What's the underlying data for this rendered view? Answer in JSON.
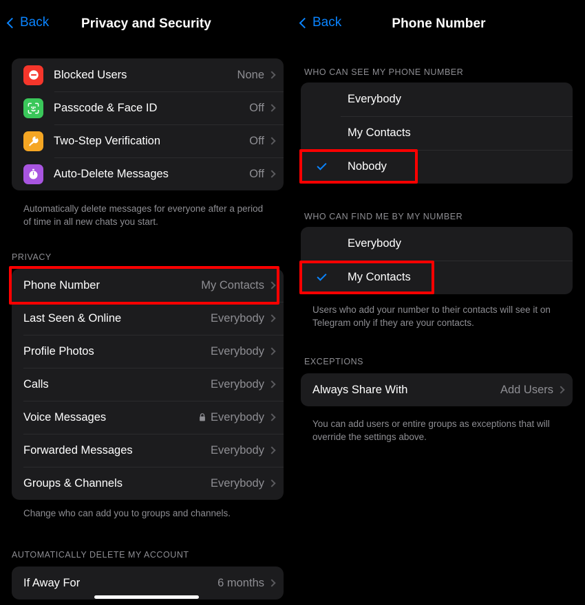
{
  "app": "Telegram iOS Settings",
  "left_panel": {
    "nav": {
      "back_label": "Back",
      "title": "Privacy and Security",
      "back_icon": "chevron-left-icon"
    },
    "security_card": {
      "rows": [
        {
          "icon": "blocked-users-icon",
          "icon_color": "#f5362b",
          "label": "Blocked Users",
          "value": "None"
        },
        {
          "icon": "face-id-icon",
          "icon_color": "#3ac75a",
          "label": "Passcode & Face ID",
          "value": "Off"
        },
        {
          "icon": "key-icon",
          "icon_color": "#f5a623",
          "label": "Two-Step Verification",
          "value": "Off"
        },
        {
          "icon": "timer-icon",
          "icon_color": "#a855e0",
          "label": "Auto-Delete Messages",
          "value": "Off"
        }
      ],
      "footnote": "Automatically delete messages for everyone after a period of time in all new chats you start."
    },
    "privacy_section": {
      "header": "PRIVACY",
      "rows": [
        {
          "label": "Phone Number",
          "value": "My Contacts",
          "highlighted": true
        },
        {
          "label": "Last Seen & Online",
          "value": "Everybody"
        },
        {
          "label": "Profile Photos",
          "value": "Everybody"
        },
        {
          "label": "Calls",
          "value": "Everybody"
        },
        {
          "label": "Voice Messages",
          "value": "Everybody",
          "lock_icon": "lock-icon"
        },
        {
          "label": "Forwarded Messages",
          "value": "Everybody"
        },
        {
          "label": "Groups & Channels",
          "value": "Everybody"
        }
      ],
      "footnote": "Change who can add you to groups and channels."
    },
    "delete_section": {
      "header": "AUTOMATICALLY DELETE MY ACCOUNT",
      "rows": [
        {
          "label": "If Away For",
          "value": "6 months"
        }
      ]
    }
  },
  "right_panel": {
    "nav": {
      "back_label": "Back",
      "title": "Phone Number",
      "back_icon": "chevron-left-icon"
    },
    "see_section": {
      "header": "WHO CAN SEE MY PHONE NUMBER",
      "options": [
        {
          "label": "Everybody",
          "selected": false
        },
        {
          "label": "My Contacts",
          "selected": false
        },
        {
          "label": "Nobody",
          "selected": true,
          "highlighted": true
        }
      ]
    },
    "find_section": {
      "header": "WHO CAN FIND ME BY MY NUMBER",
      "options": [
        {
          "label": "Everybody",
          "selected": false
        },
        {
          "label": "My Contacts",
          "selected": true,
          "highlighted": true
        }
      ],
      "footnote": "Users who add your number to their contacts will see it on Telegram only if they are your contacts."
    },
    "exceptions_section": {
      "header": "EXCEPTIONS",
      "rows": [
        {
          "label": "Always Share With",
          "value": "Add Users"
        }
      ],
      "footnote": "You can add users or entire groups as exceptions that will override the settings above."
    }
  },
  "colors": {
    "background": "#000000",
    "card": "#1c1c1e",
    "accent_blue": "#0a84ff",
    "annotation_red": "#ff0000",
    "secondary_text": "#8e8e93"
  }
}
